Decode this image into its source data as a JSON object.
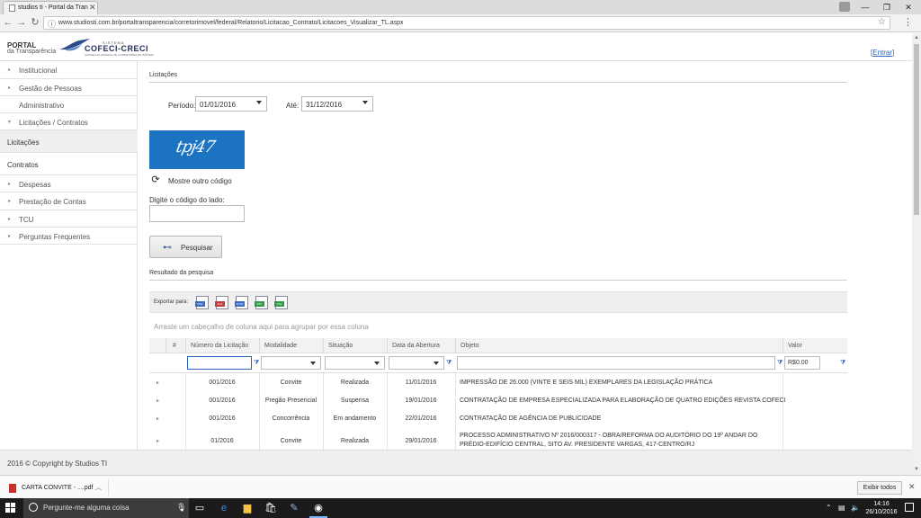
{
  "browser": {
    "tab_title": "studios ti - Portal da Tran",
    "url": "www.studiosti.com.br/portaltransparencia/corretorimovel/federal/Relatorio/Licitacao_Contrato/Licitacoes_Visualizar_TL.aspx",
    "controls": {
      "minimize": "—",
      "restore": "❐",
      "close": "✕",
      "back": "←",
      "forward": "→",
      "reload": "↻",
      "star": "☆",
      "menu": "⋮"
    }
  },
  "header": {
    "portal": "PORTAL",
    "transparencia": "da Transparência",
    "brand_small": "SISTEMA",
    "brand": "COFECI-CRECI",
    "brand_sub": "CONSELHO FEDERAL DE CORRETORES DE IMÓVEIS",
    "login_open": "[",
    "login": "Entrar",
    "login_close": "]"
  },
  "sidebar": {
    "items": [
      {
        "label": "Institucional",
        "arrow": "▸"
      },
      {
        "label": "Gestão de Pessoas",
        "arrow": "▸"
      },
      {
        "label": "Administrativo",
        "arrow": ""
      },
      {
        "label": "Licitações / Contratos",
        "arrow": "▾"
      },
      {
        "label": "Licitações",
        "arrow": ""
      },
      {
        "label": "Contratos",
        "arrow": ""
      },
      {
        "label": "Despesas",
        "arrow": "▸"
      },
      {
        "label": "Prestação de Contas",
        "arrow": "▸"
      },
      {
        "label": "TCU",
        "arrow": "▸"
      },
      {
        "label": "Perguntas Frequentes",
        "arrow": "▸"
      }
    ]
  },
  "main": {
    "section_title": "Licitações",
    "period_label": "Período:",
    "period_from": "01/01/2016",
    "until_label": "Até:",
    "period_to": "31/12/2016",
    "captcha_text": "tpj47",
    "refresh_label": "Mostre outro código",
    "code_label": "Digite o código do lado:",
    "search_button": "Pesquisar",
    "result_title": "Resultado da pesquisa",
    "export_label": "Exportar para:",
    "export_formats": [
      "PDF",
      "XLS",
      "XLSX",
      "RTF",
      "CSV"
    ],
    "group_hint": "Arraste um cabeçalho de coluna aqui para agrupar por essa coluna",
    "columns": [
      "#",
      "Número da Licitação",
      "Modalidade",
      "Situação",
      "Data da Abertura",
      "Objeto",
      "Valor"
    ],
    "value_filter": "R$0.00",
    "rows": [
      {
        "numero": "001/2016",
        "modalidade": "Convite",
        "situacao": "Realizada",
        "data": "11/01/2016",
        "objeto": [
          "IMPRESSÃO DE 26.000 (VINTE E SEIS MIL) EXEMPLARES DA LEGISLAÇÃO PRÁTICA"
        ]
      },
      {
        "numero": "001/2016",
        "modalidade": "Pregão Presencial",
        "situacao": "Suspensa",
        "data": "19/01/2016",
        "objeto": [
          "CONTRATAÇÃO DE EMPRESA ESPECIALIZADA PARA ELABORAÇÃO DE QUATRO EDIÇÕES REVISTA COFECI"
        ]
      },
      {
        "numero": "001/2016",
        "modalidade": "Concorrência",
        "situacao": "Em andamento",
        "data": "22/01/2016",
        "objeto": [
          "CONTRATAÇÃO DE AGÊNCIA DE PUBLICIDADE"
        ]
      },
      {
        "numero": "01/2016",
        "modalidade": "Convite",
        "situacao": "Realizada",
        "data": "29/01/2016",
        "objeto": [
          "PROCESSO ADMINISTRATIVO Nº 2016/000317 - OBRA/REFORMA DO AUDITÓRIO DO 19º ANDAR DO",
          "PRÉDIO-EDIFÍCIO CENTRAL, SITO AV. PRESIDENTE VARGAS, 417-CENTRO/RJ"
        ]
      }
    ]
  },
  "footer": {
    "copyright": "2016 © Copyright by Studios TI"
  },
  "downloads": {
    "file": "CARTA CONVITE - ....pdf",
    "show_all": "Exibir todos"
  },
  "taskbar": {
    "search_placeholder": "Pergunte-me alguma coisa",
    "time": "14:16",
    "date": "26/10/2016"
  },
  "colors": {
    "accent": "#2a63b8",
    "captcha_bg": "#1b73c2",
    "brand": "#1f2f5a"
  }
}
